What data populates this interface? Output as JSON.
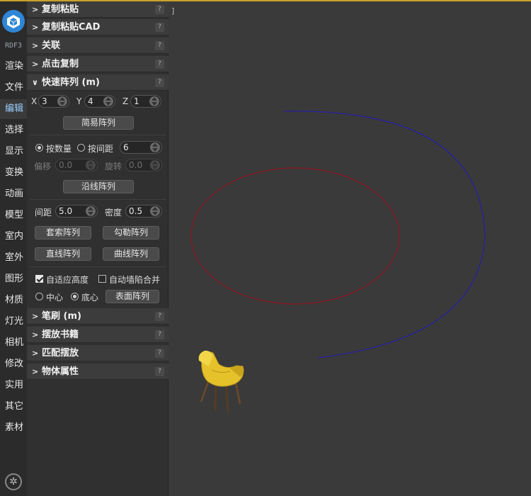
{
  "rail": {
    "version": "RDF3",
    "items": [
      {
        "label": "渲染"
      },
      {
        "label": "文件"
      },
      {
        "label": "编辑"
      },
      {
        "label": "选择"
      },
      {
        "label": "显示"
      },
      {
        "label": "变换"
      },
      {
        "label": "动画"
      },
      {
        "label": "模型"
      },
      {
        "label": "室内"
      },
      {
        "label": "室外"
      },
      {
        "label": "图形"
      },
      {
        "label": "材质"
      },
      {
        "label": "灯光"
      },
      {
        "label": "相机"
      },
      {
        "label": "修改"
      },
      {
        "label": "实用"
      },
      {
        "label": "其它"
      },
      {
        "label": "素材"
      }
    ],
    "active_index": 2
  },
  "sections": {
    "copy_paste": "复制粘贴",
    "copy_paste_cad": "复制粘贴CAD",
    "link": "关联",
    "click_copy": "点击复制",
    "quick_array": "快速阵列 (m)",
    "brush": "笔刷 (m)",
    "books": "摆放书籍",
    "match_place": "匹配摆放",
    "object_props": "物体属性",
    "help": "?"
  },
  "quick_array": {
    "x_label": "X",
    "x_value": "3",
    "y_label": "Y",
    "y_value": "4",
    "z_label": "Z",
    "z_value": "1",
    "simple_array": "简易阵列",
    "by_count": "按数量",
    "by_spacing": "按间距",
    "spacing_value": "6",
    "offset_label": "偏移",
    "offset_value": "0.0",
    "rotate_label": "旋转",
    "rotate_value": "0.0",
    "along_path": "沿线阵列",
    "gap_label": "间距",
    "gap_value": "5.0",
    "density_label": "密度",
    "density_value": "0.5",
    "lasso_array": "套索阵列",
    "outline_array": "勾勒阵列",
    "line_array": "直线阵列",
    "curve_array": "曲线阵列",
    "adapt_height": "自适应高度",
    "auto_wall_merge": "自动墙陷合并",
    "center": "中心",
    "bottom_center": "底心",
    "surface_array": "表面阵列"
  },
  "viewport": {
    "corner_mark": "]"
  },
  "colors": {
    "accent": "#c8a32b",
    "logo": "#2f86d6",
    "red_circle": "#8a1622",
    "blue_arc": "#2a1fa0",
    "chair": "#e6c22a"
  }
}
